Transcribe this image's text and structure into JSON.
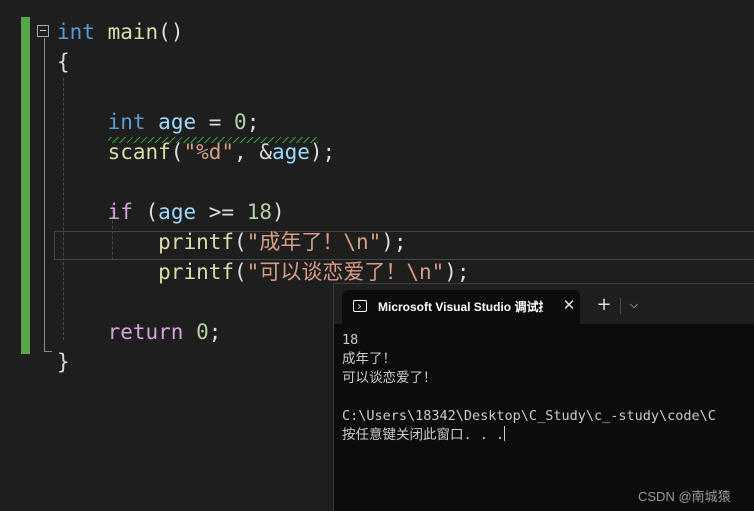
{
  "editor": {
    "lines": [
      [
        {
          "t": "int",
          "c": "kw"
        },
        {
          "t": " "
        },
        {
          "t": "main",
          "c": "fn"
        },
        {
          "t": "()"
        }
      ],
      [
        {
          "t": "{"
        }
      ],
      [],
      [
        {
          "t": "    "
        },
        {
          "t": "int",
          "c": "kw"
        },
        {
          "t": " "
        },
        {
          "t": "age",
          "c": "var"
        },
        {
          "t": " = "
        },
        {
          "t": "0",
          "c": "num"
        },
        {
          "t": ";"
        }
      ],
      [
        {
          "t": "    "
        },
        {
          "t": "scanf",
          "c": "fn"
        },
        {
          "t": "("
        },
        {
          "t": "\"%d\"",
          "c": "str"
        },
        {
          "t": ", &"
        },
        {
          "t": "age",
          "c": "var"
        },
        {
          "t": ");"
        }
      ],
      [],
      [
        {
          "t": "    "
        },
        {
          "t": "if",
          "c": "ctl"
        },
        {
          "t": " ("
        },
        {
          "t": "age",
          "c": "var"
        },
        {
          "t": " >= "
        },
        {
          "t": "18",
          "c": "num"
        },
        {
          "t": ")"
        }
      ],
      [
        {
          "t": "        "
        },
        {
          "t": "printf",
          "c": "fn"
        },
        {
          "t": "("
        },
        {
          "t": "\"成年了！\\n\"",
          "c": "str"
        },
        {
          "t": ");"
        }
      ],
      [
        {
          "t": "        "
        },
        {
          "t": "printf",
          "c": "fn"
        },
        {
          "t": "("
        },
        {
          "t": "\"可以谈恋爱了！\\n\"",
          "c": "str"
        },
        {
          "t": ");"
        }
      ],
      [],
      [
        {
          "t": "    "
        },
        {
          "t": "return",
          "c": "ctl"
        },
        {
          "t": " "
        },
        {
          "t": "0",
          "c": "num"
        },
        {
          "t": ";"
        }
      ],
      [
        {
          "t": "}"
        }
      ]
    ]
  },
  "console": {
    "tab_title": "Microsoft Visual Studio 调试控制台",
    "tab_icon": "terminal-icon",
    "close_glyph": "✕",
    "new_tab_glyph": "+",
    "dropdown_glyph": "⌵",
    "output_lines": [
      "18",
      "成年了！",
      "可以谈恋爱了！",
      "",
      "C:\\Users\\18342\\Desktop\\C_Study\\c_-study\\code\\C",
      "按任意键关闭此窗口. . ."
    ]
  },
  "watermark": "CSDN @南城猿",
  "colors": {
    "background": "#1e1e1e",
    "keyword": "#569cd6",
    "control": "#d8a0df",
    "function": "#dcdcaa",
    "variable": "#9cdcfe",
    "number": "#b5cea8",
    "string": "#d69d85",
    "change_bar": "#57a64a"
  }
}
